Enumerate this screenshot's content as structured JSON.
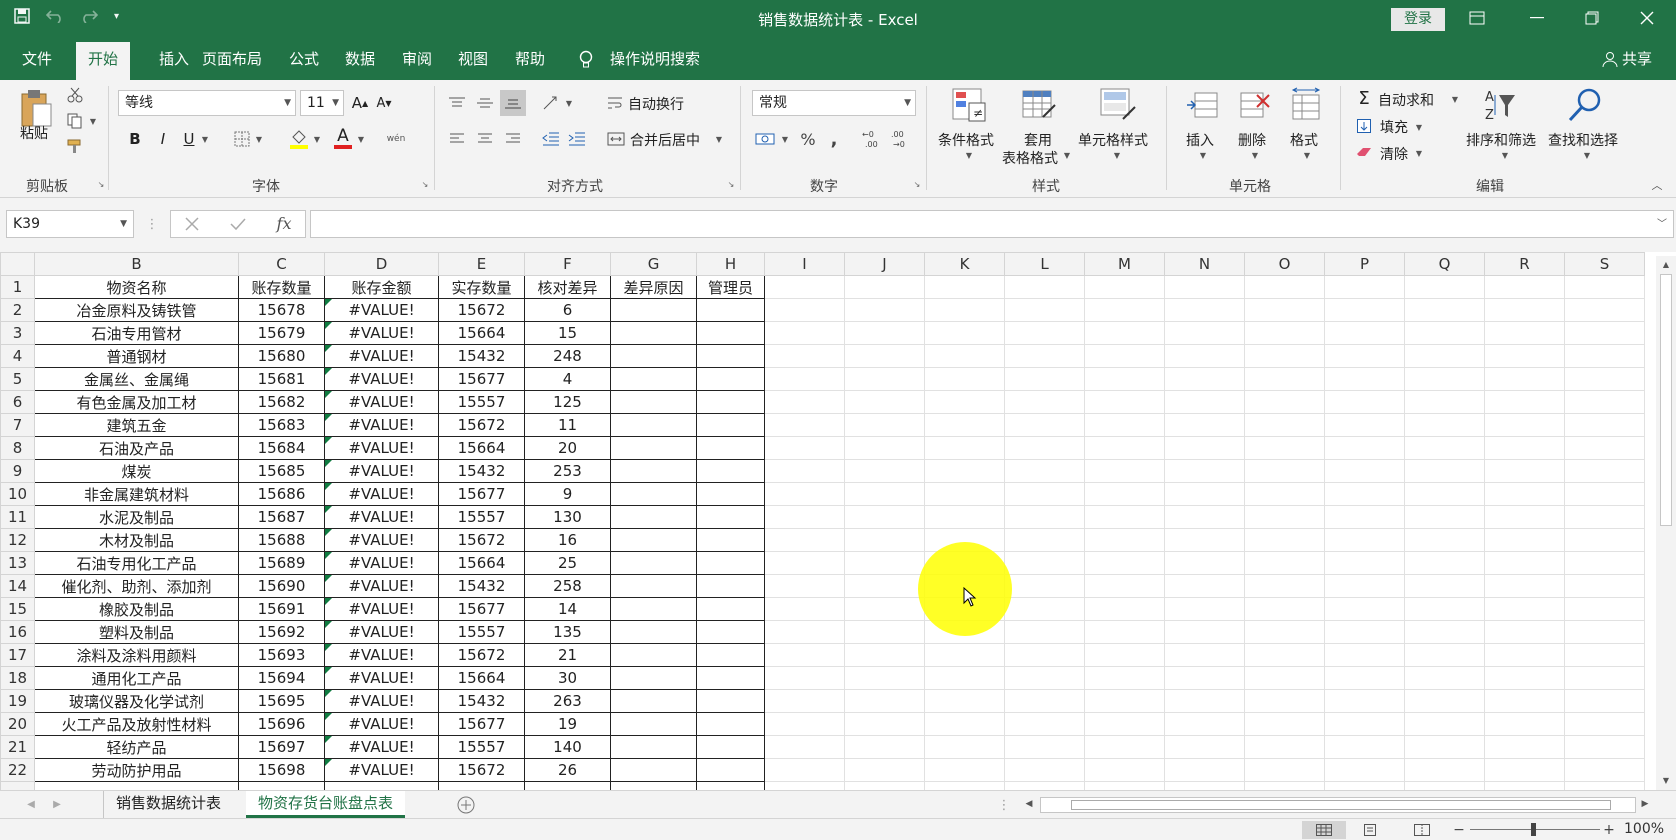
{
  "window": {
    "title": "销售数据统计表  -  Excel",
    "login": "登录"
  },
  "menu": {
    "tabs": [
      "文件",
      "开始",
      "插入",
      "页面布局",
      "公式",
      "数据",
      "审阅",
      "视图",
      "帮助"
    ],
    "active": "开始",
    "tell_me": "操作说明搜索",
    "share": "共享"
  },
  "ribbon": {
    "clipboard": {
      "paste": "粘贴",
      "label": "剪贴板"
    },
    "font": {
      "name": "等线",
      "size": "11",
      "bold": "B",
      "italic": "I",
      "underline": "U",
      "grow": "A",
      "shrink": "A",
      "label": "字体",
      "font_color": "A",
      "phonetic": "wén"
    },
    "align": {
      "wrap": "自动换行",
      "merge": "合并后居中",
      "label": "对齐方式"
    },
    "number": {
      "format": "常规",
      "percent": "%",
      "comma": ",",
      "label": "数字"
    },
    "styles": {
      "cond": "条件格式",
      "table1": "套用",
      "table2": "表格格式",
      "cell": "单元格样式",
      "label": "样式"
    },
    "cells": {
      "insert": "插入",
      "delete": "删除",
      "format": "格式",
      "label": "单元格"
    },
    "editing": {
      "autosum": "自动求和",
      "fill": "填充",
      "clear": "清除",
      "sort": "排序和筛选",
      "find": "查找和选择",
      "label": "编辑"
    }
  },
  "formula_bar": {
    "name_box": "K39",
    "fx": "fx",
    "value": ""
  },
  "columns": [
    "B",
    "C",
    "D",
    "E",
    "F",
    "G",
    "H",
    "I",
    "J",
    "K",
    "L",
    "M",
    "N",
    "O",
    "P",
    "Q",
    "R",
    "S"
  ],
  "table": {
    "headers": [
      "物资名称",
      "账存数量",
      "账存金额",
      "实存数量",
      "核对差异",
      "差异原因",
      "管理员"
    ],
    "rows": [
      {
        "r": "2",
        "name": "冶金原料及铸铁管",
        "qty": "15678",
        "amt": "#VALUE!",
        "real": "15672",
        "diff": "6"
      },
      {
        "r": "3",
        "name": "石油专用管材",
        "qty": "15679",
        "amt": "#VALUE!",
        "real": "15664",
        "diff": "15"
      },
      {
        "r": "4",
        "name": "普通钢材",
        "qty": "15680",
        "amt": "#VALUE!",
        "real": "15432",
        "diff": "248"
      },
      {
        "r": "5",
        "name": "金属丝、金属绳",
        "qty": "15681",
        "amt": "#VALUE!",
        "real": "15677",
        "diff": "4"
      },
      {
        "r": "6",
        "name": "有色金属及加工材",
        "qty": "15682",
        "amt": "#VALUE!",
        "real": "15557",
        "diff": "125"
      },
      {
        "r": "7",
        "name": "建筑五金",
        "qty": "15683",
        "amt": "#VALUE!",
        "real": "15672",
        "diff": "11"
      },
      {
        "r": "8",
        "name": "石油及产品",
        "qty": "15684",
        "amt": "#VALUE!",
        "real": "15664",
        "diff": "20"
      },
      {
        "r": "9",
        "name": "煤炭",
        "qty": "15685",
        "amt": "#VALUE!",
        "real": "15432",
        "diff": "253"
      },
      {
        "r": "10",
        "name": "非金属建筑材料",
        "qty": "15686",
        "amt": "#VALUE!",
        "real": "15677",
        "diff": "9"
      },
      {
        "r": "11",
        "name": "水泥及制品",
        "qty": "15687",
        "amt": "#VALUE!",
        "real": "15557",
        "diff": "130"
      },
      {
        "r": "12",
        "name": "木材及制品",
        "qty": "15688",
        "amt": "#VALUE!",
        "real": "15672",
        "diff": "16"
      },
      {
        "r": "13",
        "name": "石油专用化工产品",
        "qty": "15689",
        "amt": "#VALUE!",
        "real": "15664",
        "diff": "25"
      },
      {
        "r": "14",
        "name": "催化剂、助剂、添加剂",
        "qty": "15690",
        "amt": "#VALUE!",
        "real": "15432",
        "diff": "258"
      },
      {
        "r": "15",
        "name": "橡胶及制品",
        "qty": "15691",
        "amt": "#VALUE!",
        "real": "15677",
        "diff": "14"
      },
      {
        "r": "16",
        "name": "塑料及制品",
        "qty": "15692",
        "amt": "#VALUE!",
        "real": "15557",
        "diff": "135"
      },
      {
        "r": "17",
        "name": "涂料及涂料用颜料",
        "qty": "15693",
        "amt": "#VALUE!",
        "real": "15672",
        "diff": "21"
      },
      {
        "r": "18",
        "name": "通用化工产品",
        "qty": "15694",
        "amt": "#VALUE!",
        "real": "15664",
        "diff": "30"
      },
      {
        "r": "19",
        "name": "玻璃仪器及化学试剂",
        "qty": "15695",
        "amt": "#VALUE!",
        "real": "15432",
        "diff": "263"
      },
      {
        "r": "20",
        "name": "火工产品及放射性材料",
        "qty": "15696",
        "amt": "#VALUE!",
        "real": "15677",
        "diff": "19"
      },
      {
        "r": "21",
        "name": "轻纺产品",
        "qty": "15697",
        "amt": "#VALUE!",
        "real": "15557",
        "diff": "140"
      },
      {
        "r": "22",
        "name": "劳动防护用品",
        "qty": "15698",
        "amt": "#VALUE!",
        "real": "15672",
        "diff": "26"
      }
    ]
  },
  "sheets": [
    "销售数据统计表",
    "物资存货台账盘点表"
  ],
  "active_sheet": "物资存货台账盘点表",
  "status": {
    "zoom": "100%"
  },
  "colors": {
    "brand": "#217346",
    "highlight": "#ffff00"
  }
}
